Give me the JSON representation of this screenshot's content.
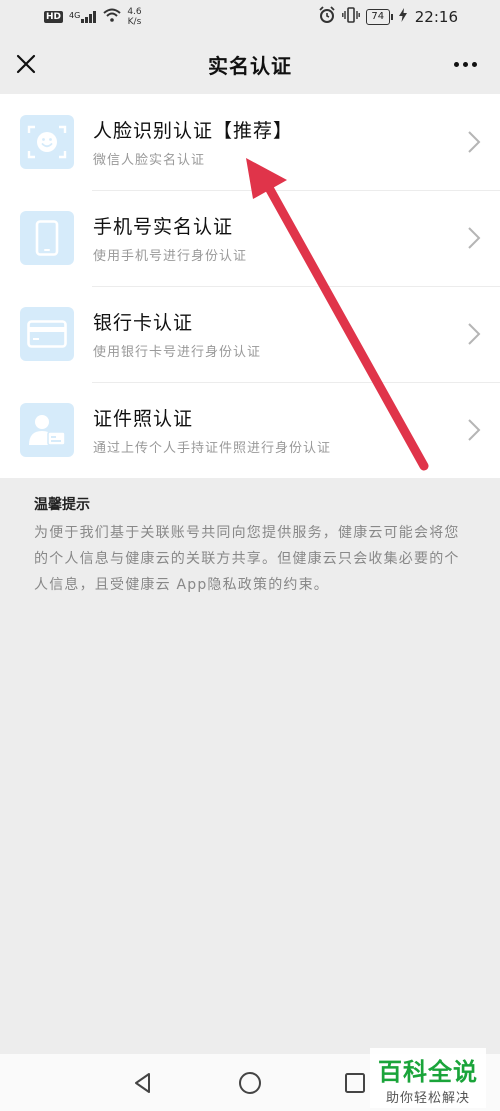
{
  "status_bar": {
    "hd_badge": "HD",
    "network_type": "4G",
    "net_speed_value": "4.6",
    "net_speed_unit": "K/s",
    "battery_level": "74",
    "time": "22:16"
  },
  "header": {
    "title": "实名认证"
  },
  "auth_methods": [
    {
      "title": "人脸识别认证【推荐】",
      "subtitle": "微信人脸实名认证",
      "icon": "face-scan-icon"
    },
    {
      "title": "手机号实名认证",
      "subtitle": "使用手机号进行身份认证",
      "icon": "phone-icon"
    },
    {
      "title": "银行卡认证",
      "subtitle": "使用银行卡号进行身份认证",
      "icon": "bank-card-icon"
    },
    {
      "title": "证件照认证",
      "subtitle": "通过上传个人手持证件照进行身份认证",
      "icon": "id-photo-icon"
    }
  ],
  "tips": {
    "title": "温馨提示",
    "body": "为便于我们基于关联账号共同向您提供服务，健康云可能会将您的个人信息与健康云的关联方共享。但健康云只会收集必要的个人信息，且受健康云 App隐私政策的约束。"
  },
  "watermark": {
    "main": "百科全说",
    "sub": "助你轻松解决"
  },
  "colors": {
    "background": "#ededed",
    "icon_bg": "#d6ebfa",
    "icon_fg": "#ffffff",
    "annotation_arrow": "#e0344a",
    "watermark_green": "#1aa43a"
  }
}
